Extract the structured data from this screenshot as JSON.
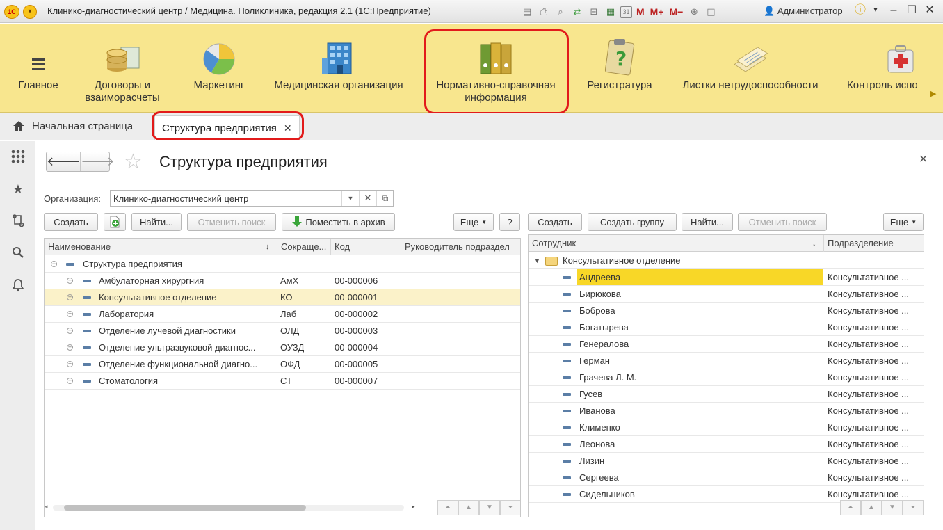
{
  "window": {
    "title": "Клинико-диагностический центр / Медицина. Поликлиника, редакция 2.1  (1С:Предприятие)",
    "logo": "1С",
    "user": "Администратор",
    "toolbar_icons": [
      "save-icon",
      "print-icon",
      "preview-icon",
      "back-and-forward-icon",
      "scanner-icon",
      "calculator-icon",
      "calendar-icon"
    ],
    "calendar_label": "31",
    "memory_buttons": [
      "M",
      "M+",
      "M−"
    ]
  },
  "sections": [
    {
      "label": "Главное",
      "icon": "menu-lines-icon"
    },
    {
      "label": "Договоры и\nвзаиморасчеты",
      "icon": "coins-icon"
    },
    {
      "label": "Маркетинг",
      "icon": "pie-chart-icon"
    },
    {
      "label": "Медицинская организация",
      "icon": "building-icon"
    },
    {
      "label": "Нормативно-справочная\nинформация",
      "icon": "binders-icon"
    },
    {
      "label": "Регистратура",
      "icon": "clipboard-question-icon"
    },
    {
      "label": "Листки нетрудоспособности",
      "icon": "papers-icon"
    },
    {
      "label": "Контроль испо",
      "icon": "first-aid-icon"
    }
  ],
  "tabs": {
    "home": "Начальная страница",
    "active": "Структура предприятия"
  },
  "form": {
    "title": "Структура предприятия",
    "org_label": "Организация:",
    "org_value": "Клинико-диагностический центр",
    "left_buttons": {
      "create": "Создать",
      "find": "Найти...",
      "cancel_search": "Отменить поиск",
      "archive": "Поместить в архив",
      "more": "Еще",
      "help": "?"
    },
    "right_buttons": {
      "create": "Создать",
      "create_group": "Создать группу",
      "find": "Найти...",
      "cancel_search": "Отменить поиск",
      "more": "Еще"
    }
  },
  "units_table": {
    "columns": [
      "Наименование",
      "Сокраще...",
      "Код",
      "Руководитель подраздел"
    ],
    "root": "Структура предприятия",
    "rows": [
      {
        "name": "Амбулаторная хирургния",
        "short": "АмХ",
        "code": "00-000006"
      },
      {
        "name": "Консультативное отделение",
        "short": "КО",
        "code": "00-000001",
        "selected": true
      },
      {
        "name": "Лаборатория",
        "short": "Лаб",
        "code": "00-000002"
      },
      {
        "name": "Отделение лучевой диагностики",
        "short": "ОЛД",
        "code": "00-000003"
      },
      {
        "name": "Отделение ультразвуковой диагнос...",
        "short": "ОУЗД",
        "code": "00-000004"
      },
      {
        "name": "Отделение функциональной диагно...",
        "short": "ОФД",
        "code": "00-000005"
      },
      {
        "name": "Стоматология",
        "short": "СТ",
        "code": "00-000007"
      }
    ]
  },
  "staff_table": {
    "columns": [
      "Сотрудник",
      "Подразделение"
    ],
    "group": "Консультативное отделение",
    "department_short": "Консультативное ...",
    "rows": [
      "Андреева",
      "Бирюкова",
      "Боброва",
      "Богатырева",
      "Генералова",
      "Герман",
      "Грачева Л. М.",
      "Гусев",
      "Иванова",
      "Клименко",
      "Леонова",
      "Лизин",
      "Сергеева",
      "Сидельников"
    ]
  }
}
